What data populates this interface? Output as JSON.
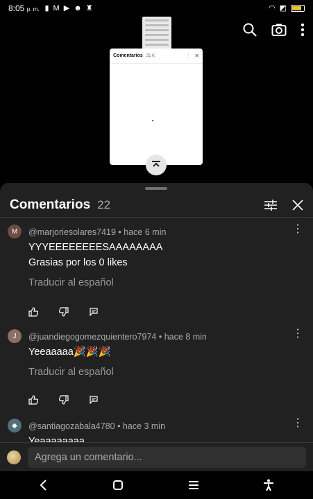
{
  "status_bar": {
    "time": "8:05",
    "ampm": "p. m."
  },
  "video": {
    "mini_title": "Comentarios",
    "mini_count": "21 K"
  },
  "sheet": {
    "title": "Comentarios",
    "count": "22"
  },
  "comments": [
    {
      "avatar_letter": "M",
      "avatar_color": "#6d4c41",
      "author": "@marjoriesolares7419",
      "time": "hace 6 min",
      "lines": [
        "YYYEEEEEEEESAAAAAAAA",
        "Grasias por los 0 likes"
      ],
      "translate": "Traducir al español"
    },
    {
      "avatar_letter": "J",
      "avatar_color": "#8d6e63",
      "author": "@juandiegogomezquientero7974",
      "time": "hace 8 min",
      "lines": [
        "Yeeaaaaa🎉🎉🎉"
      ],
      "translate": "Traducir al español"
    },
    {
      "avatar_letter": "",
      "avatar_color": "#546e7a",
      "author": "@santiagozabala4780",
      "time": "hace 3 min",
      "lines": [
        "Yeaaaaaaaa"
      ],
      "translate": ""
    }
  ],
  "composer": {
    "placeholder": "Agrega un comentario..."
  },
  "separator": " • "
}
